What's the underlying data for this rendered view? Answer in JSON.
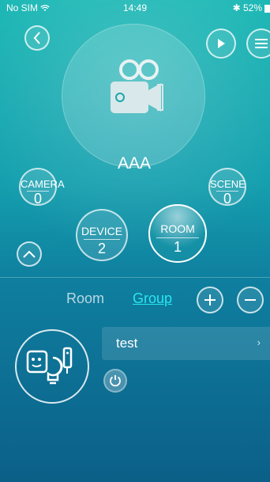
{
  "status_bar": {
    "carrier": "No SIM",
    "time": "14:49",
    "battery": "52%",
    "battery_level": 0.52
  },
  "header": {
    "back_icon": "chevron-left-icon",
    "play_icon": "play-icon",
    "menu_icon": "menu-icon"
  },
  "camera": {
    "name": "AAA",
    "icon": "video-camera-icon"
  },
  "stats": {
    "camera": {
      "label": "CAMERA",
      "value": "0"
    },
    "scene": {
      "label": "SCENE",
      "value": "0"
    },
    "device": {
      "label": "DEVICE",
      "value": "2"
    },
    "room": {
      "label": "ROOM",
      "value": "1"
    }
  },
  "tabs": {
    "room_label": "Room",
    "group_label": "Group",
    "active": "Group"
  },
  "group_list": [
    {
      "name": "test",
      "icon": "camera-bulb-device-icon"
    }
  ],
  "colors": {
    "accent": "#27e6ee",
    "background_top": "#1ab7b4",
    "background_bottom": "#0b5f88"
  }
}
